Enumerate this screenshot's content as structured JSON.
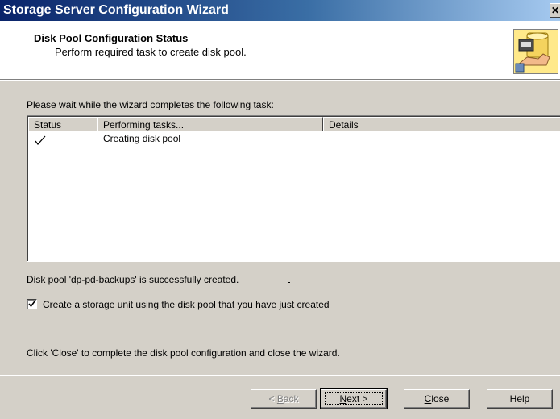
{
  "window": {
    "title": "Storage Server Configuration Wizard",
    "close_glyph": "✕"
  },
  "header": {
    "title": "Disk Pool Configuration Status",
    "subtitle": "Perform required task to create disk pool."
  },
  "instruction": "Please wait while the wizard completes the following task:",
  "task_list": {
    "columns": [
      "Status",
      "Performing tasks...",
      "Details"
    ],
    "rows": [
      {
        "status_icon": "checkmark-icon",
        "task": "Creating disk pool",
        "details": ""
      }
    ]
  },
  "result_message": "Disk pool 'dp-pd-backups' is successfully created.",
  "storage_unit_checkbox": {
    "checked": true,
    "label_before": "Create a ",
    "label_mnemonic": "s",
    "label_after": "torage unit using the disk pool that you have just created"
  },
  "close_instruction": "Click 'Close' to complete the disk pool configuration and close the wizard.",
  "buttons": {
    "back": {
      "pre": "< ",
      "mnemonic": "B",
      "post": "ack",
      "enabled": false
    },
    "next": {
      "pre": "",
      "mnemonic": "N",
      "post": "ext >",
      "enabled": true
    },
    "close": {
      "pre": "",
      "mnemonic": "C",
      "post": "lose",
      "enabled": true
    },
    "help": {
      "label": "Help",
      "enabled": true
    }
  }
}
